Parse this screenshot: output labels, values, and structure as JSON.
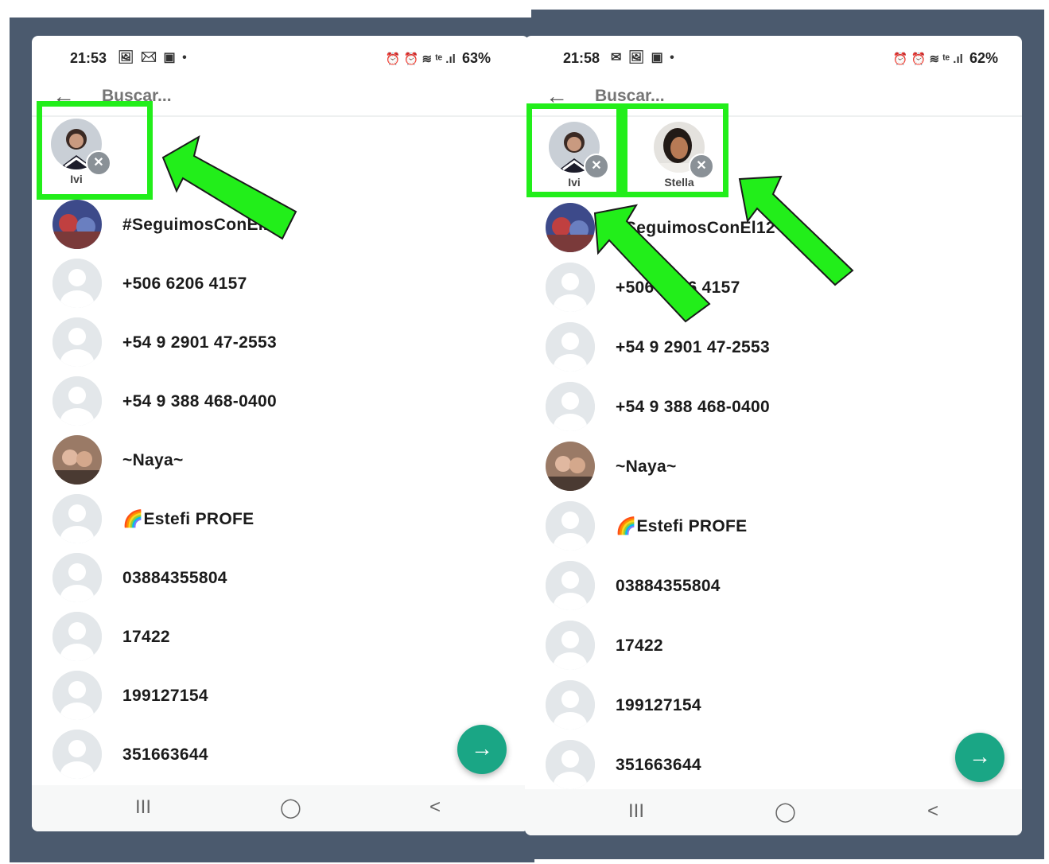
{
  "left": {
    "status": {
      "time": "21:53",
      "left_icons": "🖼 ✉ ▣ •",
      "right_icons": "⏰ ⏰ ≋ ᵗᵉ .ıl",
      "battery": "63%"
    },
    "search": {
      "placeholder": "Buscar..."
    },
    "selected": [
      {
        "name": "Ivi"
      }
    ],
    "contacts": [
      {
        "name": "#SeguimosConEl12"
      },
      {
        "name": "+506 6206 4157"
      },
      {
        "name": "+54 9 2901 47-2553"
      },
      {
        "name": "+54 9 388 468-0400"
      },
      {
        "name": "~Naya~"
      },
      {
        "name": "🌈Estefi PROFE"
      },
      {
        "name": "03884355804"
      },
      {
        "name": "17422"
      },
      {
        "name": "199127154"
      },
      {
        "name": "351663644"
      }
    ],
    "fab": "→",
    "nav": {
      "recents": "III",
      "home": "◯",
      "back": "<"
    }
  },
  "right": {
    "status": {
      "time": "21:58",
      "left_icons": "✉ 🖼 ▣ •",
      "right_icons": "⏰ ⏰ ≋ ᵗᵉ .ıl",
      "battery": "62%"
    },
    "search": {
      "placeholder": "Buscar..."
    },
    "selected": [
      {
        "name": "Ivi"
      },
      {
        "name": "Stella"
      }
    ],
    "contacts": [
      {
        "name": "#SeguimosConEl12"
      },
      {
        "name": "+506 6206 4157"
      },
      {
        "name": "+54 9 2901 47-2553"
      },
      {
        "name": "+54 9 388 468-0400"
      },
      {
        "name": "~Naya~"
      },
      {
        "name": "🌈Estefi PROFE"
      },
      {
        "name": "03884355804"
      },
      {
        "name": "17422"
      },
      {
        "name": "199127154"
      },
      {
        "name": "351663644"
      }
    ],
    "fab": "→",
    "nav": {
      "recents": "III",
      "home": "◯",
      "back": "<"
    }
  },
  "colors": {
    "frame": "#4b5a6e",
    "highlight": "#22ee1a",
    "fab": "#1aa685"
  }
}
